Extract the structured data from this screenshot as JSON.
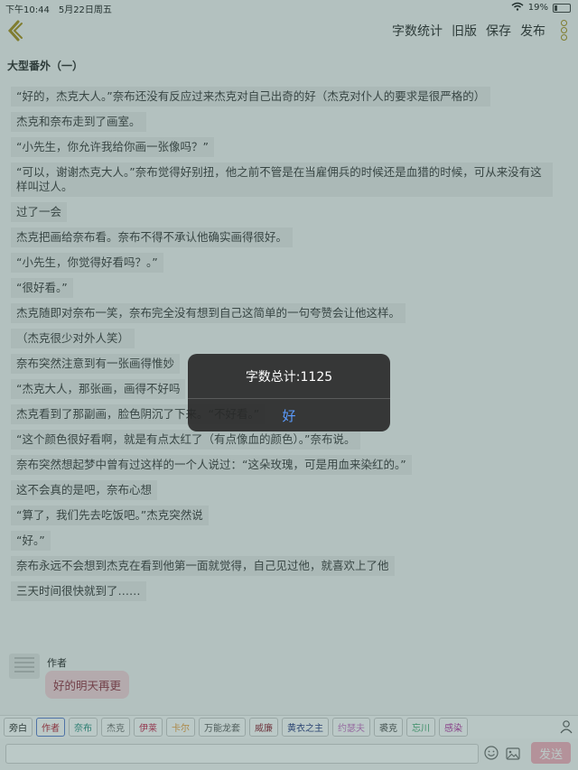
{
  "status": {
    "time": "下午10:44",
    "date": "5月22日周五",
    "battery": "19%"
  },
  "nav": {
    "actions": [
      "字数统计",
      "旧版",
      "保存",
      "发布"
    ]
  },
  "title": "大型番外（一）",
  "paragraphs": [
    "“好的，杰克大人。”奈布还没有反应过来杰克对自己出奇的好（杰克对仆人的要求是很严格的）",
    "杰克和奈布走到了画室。",
    "“小先生，你允许我给你画一张像吗？”",
    "“可以，谢谢杰克大人。”奈布觉得好别扭，他之前不管是在当雇佣兵的时候还是血猎的时候，可从来没有这样叫过人。",
    "过了一会",
    "杰克把画给奈布看。奈布不得不承认他确实画得很好。",
    "“小先生，你觉得好看吗？。”",
    "“很好看。”",
    "杰克随即对奈布一笑，奈布完全没有想到自己这简单的一句夸赞会让他这样。",
    "（杰克很少对外人笑）",
    "奈布突然注意到有一张画得惟妙",
    "“杰克大人，那张画，画得不好吗",
    "杰克看到了那副画，脸色阴沉了下来。“不好看。”",
    "“这个颜色很好看啊，就是有点太红了（有点像血的颜色）。”奈布说。",
    "奈布突然想起梦中曾有过这样的一个人说过：“这朵玫瑰，可是用血来染红的。”",
    "这不会真的是吧，奈布心想",
    "“算了，我们先去吃饭吧。”杰克突然说",
    "“好。”",
    "奈布永远不会想到杰克在看到他第一面就觉得，自己见过他，就喜欢上了他",
    "三天时间很快就到了……"
  ],
  "author": {
    "label": "作者",
    "message": "好的明天再更"
  },
  "characters": [
    {
      "name": "旁白",
      "color": "#222222"
    },
    {
      "name": "作者",
      "color": "#b3172b"
    },
    {
      "name": "奈布",
      "color": "#1f8a7a"
    },
    {
      "name": "杰克",
      "color": "#666666"
    },
    {
      "name": "伊莱",
      "color": "#c21d45"
    },
    {
      "name": "卡尔",
      "color": "#e89b39"
    },
    {
      "name": "万能龙套",
      "color": "#555555"
    },
    {
      "name": "威廉",
      "color": "#8a1f2e"
    },
    {
      "name": "黄衣之主",
      "color": "#1d2f7a"
    },
    {
      "name": "约瑟夫",
      "color": "#c66fc4"
    },
    {
      "name": "裘克",
      "color": "#444444"
    },
    {
      "name": "忘川",
      "color": "#3aa36a"
    },
    {
      "name": "感染",
      "color": "#b12fa0"
    }
  ],
  "input": {
    "placeholder": "",
    "send_label": "发送"
  },
  "dialog": {
    "message": "字数总计:1125",
    "ok_label": "好"
  },
  "colors": {
    "accent": "#a38812",
    "send": "#f4a9b9",
    "dialog_ok": "#5b9cff"
  }
}
